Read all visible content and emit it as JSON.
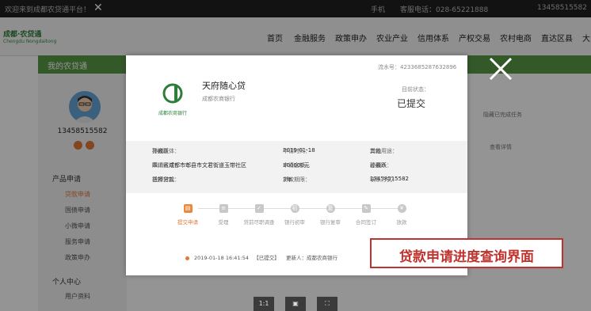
{
  "topbar": {
    "left_text": "欢迎来到成都农贷通平台！",
    "close_glyph": "✕",
    "phone_label": "手机",
    "hotline": "客服电话：028-65221888",
    "user": "13458515582"
  },
  "navbar": {
    "logo_name": "成都·农贷通",
    "logo_sub": "Chengdu Nongdaitong",
    "items": [
      "首页",
      "金融服务",
      "政策申办",
      "农业产业",
      "信用体系",
      "产权交易",
      "农村电商",
      "直达区县",
      "大"
    ]
  },
  "subheader": {
    "title": "我的农贷通"
  },
  "sidebar": {
    "phone": "13458515582",
    "section1": "产品申请",
    "items1": [
      "贷款申请",
      "国债申请",
      "小微申请",
      "服务申请",
      "政策申办"
    ],
    "section2": "个人中心",
    "items2": [
      "用户资料"
    ]
  },
  "background_right": {
    "filter_label": "隐藏已完成任务",
    "detail_link": "查看详情"
  },
  "modal": {
    "serial": "流水号：4233685287632896",
    "product_name": "天府随心贷",
    "bank": "成都农商银行",
    "logo_caption": "成都农商银行",
    "status_label": "目前状态：",
    "status_value": "已提交",
    "info": {
      "subject_label": "贷款主体：",
      "subject": "孙巍跃",
      "apply_time_label": "申请时间：",
      "apply_time": "2019-01-18",
      "purpose_label": "贷款用途：",
      "purpose": "其他",
      "region_label": "申请区域：",
      "region": "四川省成都市郫县市文君街道玉带社区",
      "amount_label": "申请金额：",
      "amount": "300000元",
      "contact_label": "联系人：",
      "contact": "孙巍跃",
      "method_label": "贷款方式：",
      "method": "抵押贷款",
      "term_label": "贷款期限：",
      "term": "3年",
      "phone_label": "联系方式：",
      "phone": "13458515582"
    },
    "steps": [
      "提交申请",
      "受理",
      "贷前尽职调查",
      "银行初审",
      "银行复审",
      "合同签订",
      "放款"
    ],
    "step_icons": [
      "document-icon",
      "list-icon",
      "checklist-icon",
      "first-review-icon",
      "second-review-icon",
      "contract-icon",
      "money-icon"
    ],
    "log": {
      "time": "2019-01-18 16:41:54",
      "status": "【已提交】",
      "updater": "更新人：成都农商银行"
    }
  },
  "banner": {
    "text": "贷款申请进度查询界面"
  },
  "toolbar": {
    "zoom_label": "1:1"
  },
  "colors": {
    "accent_orange": "#e0793a",
    "green": "#5b9a47",
    "banner_red": "#c0322d"
  }
}
